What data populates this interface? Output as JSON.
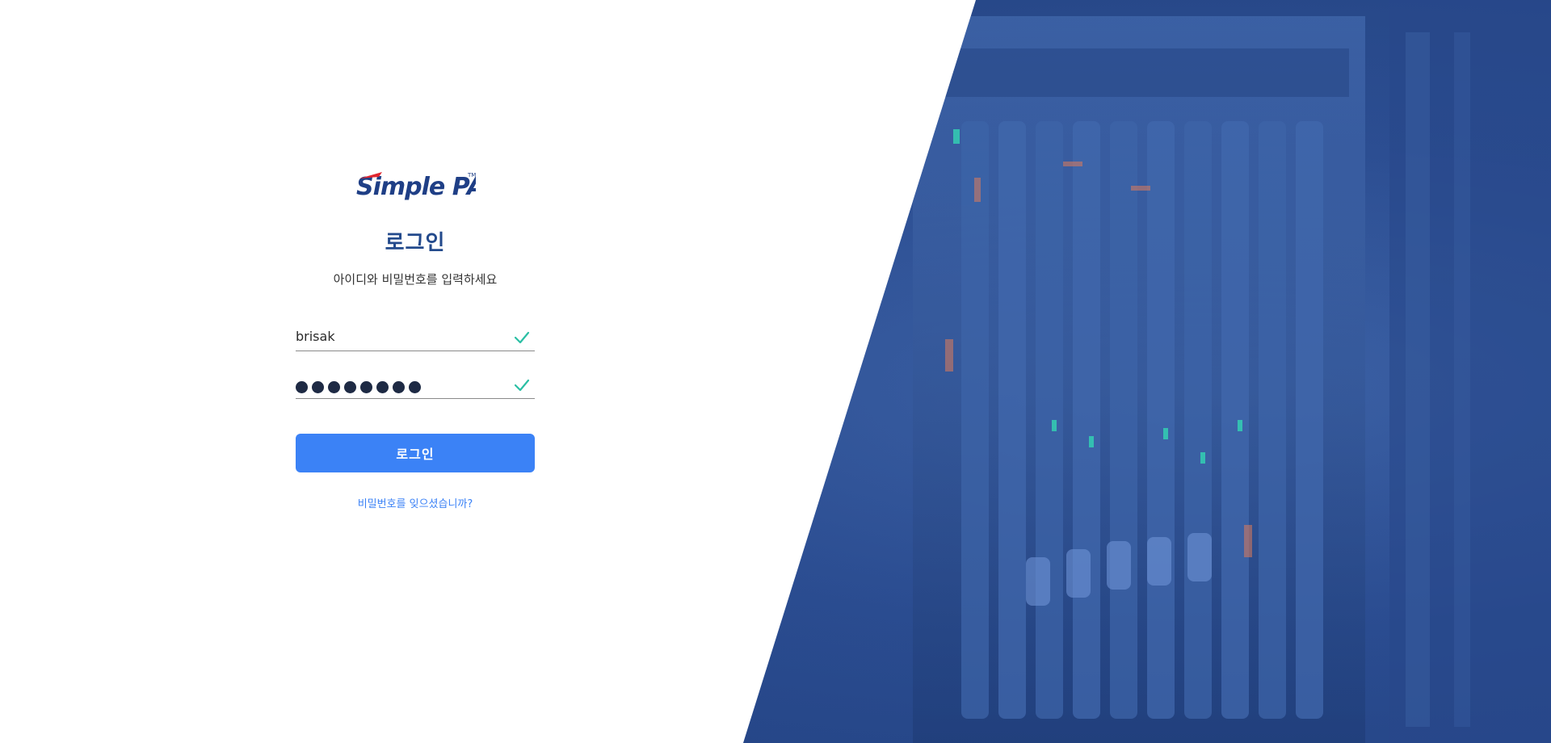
{
  "brand": {
    "logo_text": "Simple PA",
    "logo_mark": "TM"
  },
  "login": {
    "title": "로그인",
    "subtitle": "아이디와 비밀번호를 입력하세요",
    "username_value": "brisak",
    "password_mask_length": 8,
    "submit_label": "로그인",
    "forgot_link": "비밀번호를 잊으셨습니까?"
  },
  "colors": {
    "accent": "#3b82f6",
    "title": "#234a8c",
    "valid_check": "#2bbfa4",
    "hero_blue": "#2c4e92"
  },
  "icons": {
    "username_status": "check-icon",
    "password_status": "check-icon"
  }
}
